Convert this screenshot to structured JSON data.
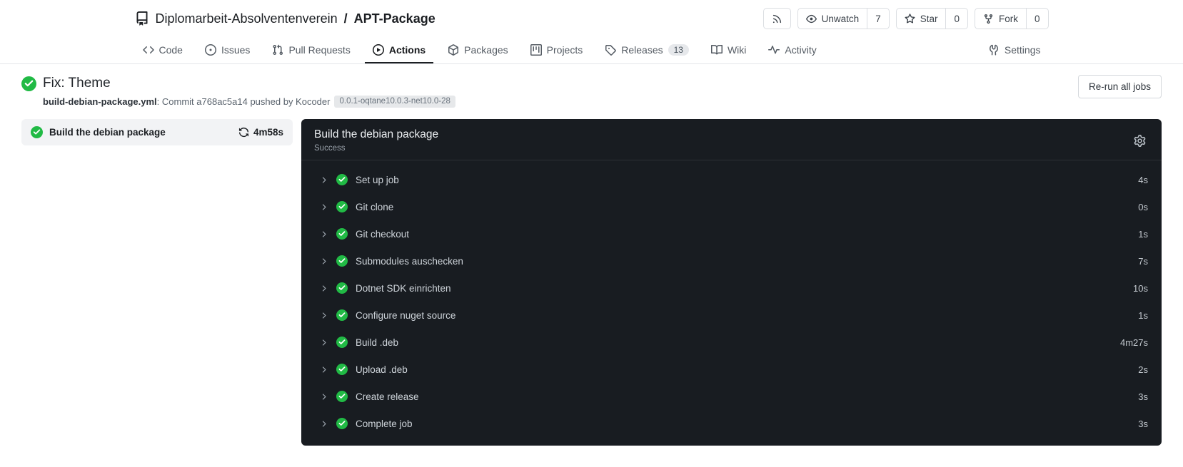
{
  "header": {
    "repo_owner": "Diplomarbeit-Absolventenverein",
    "separator": "/",
    "repo_name": "APT-Package",
    "buttons": {
      "watch_label": "Unwatch",
      "watch_count": "7",
      "star_label": "Star",
      "star_count": "0",
      "fork_label": "Fork",
      "fork_count": "0"
    }
  },
  "tabs": {
    "code": "Code",
    "issues": "Issues",
    "pull_requests": "Pull Requests",
    "actions": "Actions",
    "packages": "Packages",
    "projects": "Projects",
    "releases": "Releases",
    "releases_badge": "13",
    "wiki": "Wiki",
    "activity": "Activity",
    "settings": "Settings"
  },
  "run": {
    "title": "Fix: Theme",
    "workflow_file": "build-debian-package.yml",
    "commit_text": ": Commit a768ac5a14 pushed by Kocoder",
    "ref_badge": "0.0.1-oqtane10.0.3-net10.0-28",
    "rerun_button": "Re-run all jobs"
  },
  "job": {
    "name": "Build the debian package",
    "duration": "4m58s"
  },
  "console": {
    "title": "Build the debian package",
    "status": "Success",
    "steps": [
      {
        "name": "Set up job",
        "duration": "4s"
      },
      {
        "name": "Git clone",
        "duration": "0s"
      },
      {
        "name": "Git checkout",
        "duration": "1s"
      },
      {
        "name": "Submodules auschecken",
        "duration": "7s"
      },
      {
        "name": "Dotnet SDK einrichten",
        "duration": "10s"
      },
      {
        "name": "Configure nuget source",
        "duration": "1s"
      },
      {
        "name": "Build .deb",
        "duration": "4m27s"
      },
      {
        "name": "Upload .deb",
        "duration": "2s"
      },
      {
        "name": "Create release",
        "duration": "3s"
      },
      {
        "name": "Complete job",
        "duration": "3s"
      }
    ]
  },
  "colors": {
    "success_green": "#21ba45",
    "console_bg": "#181c21"
  }
}
